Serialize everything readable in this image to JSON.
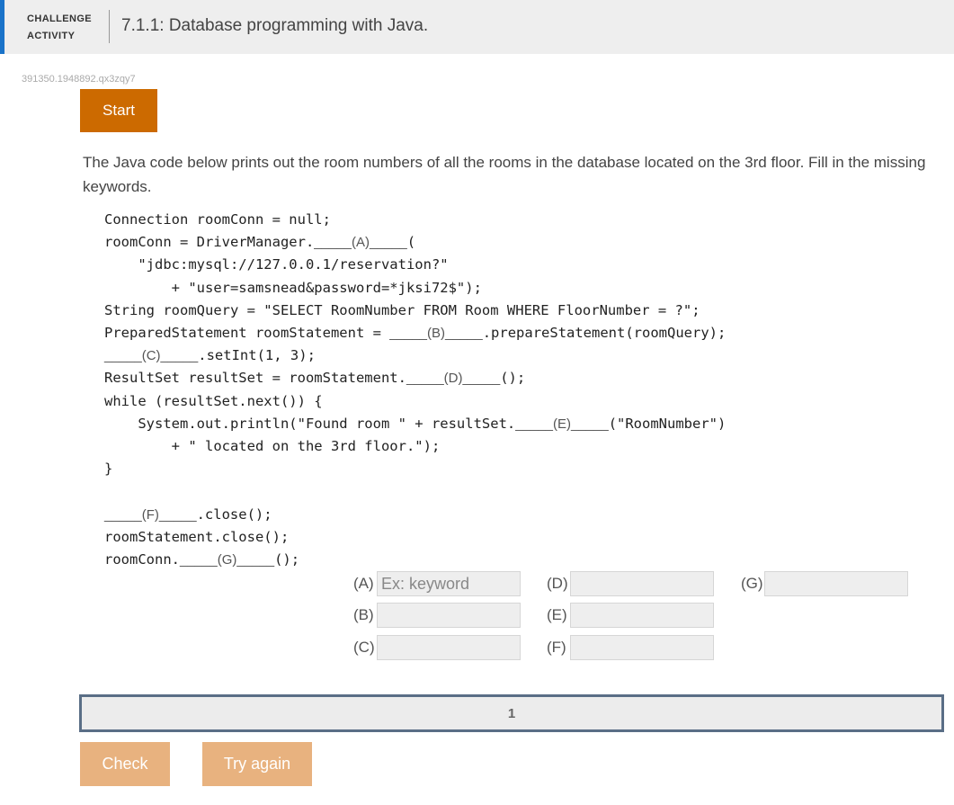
{
  "header": {
    "label_line1": "CHALLENGE",
    "label_line2": "ACTIVITY",
    "title": "7.1.1: Database programming with Java.",
    "accent_color": "#1a73c9"
  },
  "activity_id": "391350.1948892.qx3zqy7",
  "start_button": {
    "label": "Start",
    "color": "#cc6a00"
  },
  "instructions": "The Java code below prints out the room numbers of all the rooms in the database located on the 3rd floor. Fill in the missing keywords.",
  "code": {
    "line1": "Connection roomConn = null;",
    "line2_pre": "roomConn = DriverManager.",
    "blank_A": "_____(A)_____",
    "line2_post": "(",
    "line3": "    \"jdbc:mysql://127.0.0.1/reservation?\"",
    "line4": "        + \"user=samsnead&password=*jksi72$\");",
    "line5": "String roomQuery = \"SELECT RoomNumber FROM Room WHERE FloorNumber = ?\";",
    "line6_pre": "PreparedStatement roomStatement = ",
    "blank_B": "_____(B)_____",
    "line6_post": ".prepareStatement(roomQuery);",
    "blank_C": "_____(C)_____",
    "line7_post": ".setInt(1, 3);",
    "line8_pre": "ResultSet resultSet = roomStatement.",
    "blank_D": "_____(D)_____",
    "line8_post": "();",
    "line9": "while (resultSet.next()) {",
    "line10_pre": "    System.out.println(\"Found room \" + resultSet.",
    "blank_E": "_____(E)_____",
    "line10_post": "(\"RoomNumber\")",
    "line11": "        + \" located on the 3rd floor.\");",
    "line12": "}",
    "blank_F": "_____(F)_____",
    "line14_post": ".close();",
    "line15": "roomStatement.close();",
    "line16_pre": "roomConn.",
    "blank_G": "_____(G)_____",
    "line16_post": "();"
  },
  "fields": {
    "A": {
      "label": "(A)",
      "placeholder": "Ex: keyword",
      "value": ""
    },
    "B": {
      "label": "(B)",
      "value": ""
    },
    "C": {
      "label": "(C)",
      "value": ""
    },
    "D": {
      "label": "(D)",
      "value": ""
    },
    "E": {
      "label": "(E)",
      "value": ""
    },
    "F": {
      "label": "(F)",
      "value": ""
    },
    "G": {
      "label": "(G)",
      "value": ""
    }
  },
  "progress": {
    "current_step": "1"
  },
  "buttons": {
    "check": "Check",
    "try_again": "Try again"
  }
}
